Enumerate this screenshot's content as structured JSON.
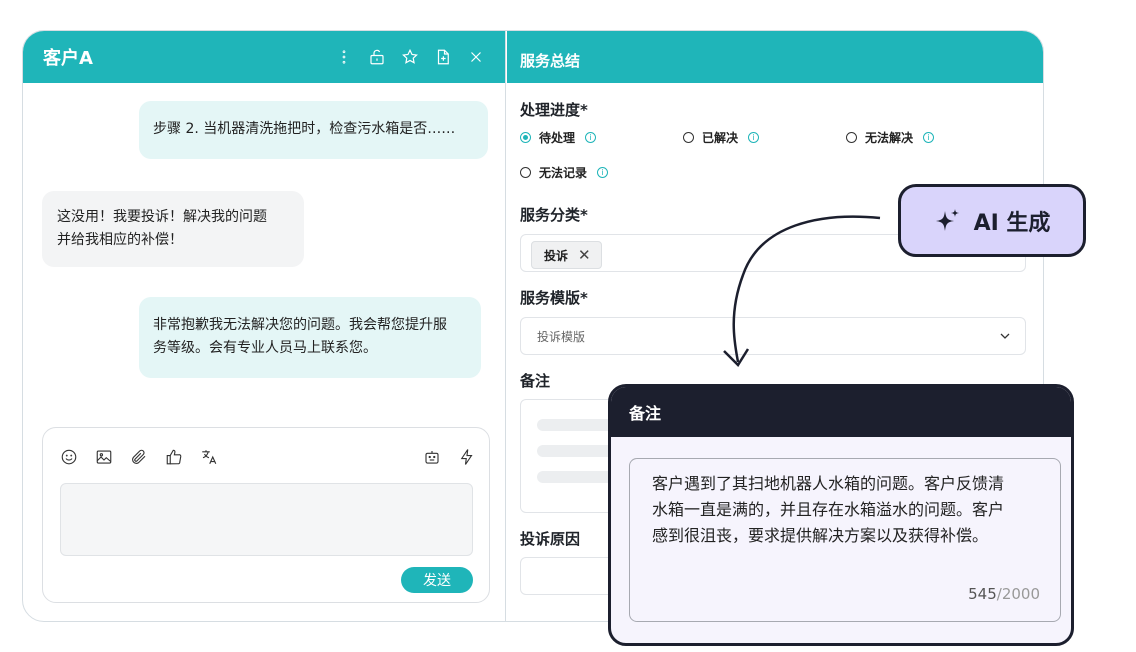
{
  "chat": {
    "title": "客户A",
    "messages": [
      {
        "role": "agent",
        "text": "步骤 2. 当机器清洗拖把时，检查污水箱是否……"
      },
      {
        "role": "customer",
        "line1": "这没用！我要投诉！解决我的问题",
        "line2": "并给我相应的补偿！"
      },
      {
        "role": "agent",
        "line1": "非常抱歉我无法解决您的问题。我会帮您提升服",
        "line2": "务等级。会有专业人员马上联系您。"
      }
    ],
    "send_label": "发送"
  },
  "summary": {
    "title": "服务总结",
    "progress_label": "处理进度*",
    "progress_options": [
      {
        "label": "待处理",
        "selected": true
      },
      {
        "label": "已解决",
        "selected": false
      },
      {
        "label": "无法解决",
        "selected": false
      },
      {
        "label": "无法记录",
        "selected": false
      }
    ],
    "category_label": "服务分类*",
    "category_tag": "投诉",
    "template_label": "服务模版*",
    "template_value": "投诉模版",
    "notes_label": "备注",
    "complaint_reason_label": "投诉原因"
  },
  "ai_button": {
    "label": "AI 生成"
  },
  "note_card": {
    "title": "备注",
    "lines": [
      "客户遇到了其扫地机器人水箱的问题。客户反馈清",
      "水箱一直是满的，并且存在水箱溢水的问题。客户",
      "感到很沮丧，要求提供解决方案以及获得补偿。"
    ],
    "count": "545",
    "max": "/2000"
  },
  "colors": {
    "accent": "#1fb5b9",
    "dark": "#1c1f2e",
    "ai_bg": "#d9d4fb"
  }
}
